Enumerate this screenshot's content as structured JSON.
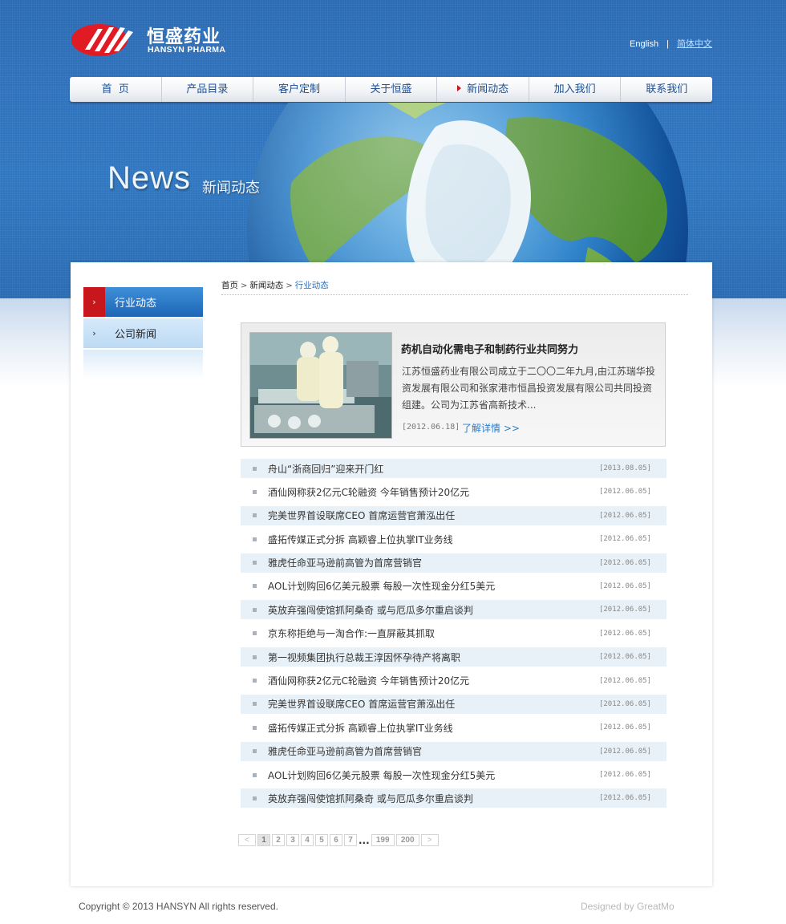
{
  "brand": {
    "name_cn": "恒盛药业",
    "name_en": "HANSYN PHARMA",
    "colors": {
      "primary_blue": "#2c6bb3",
      "accent_red": "#c8161d",
      "link_blue": "#2a7ec9"
    }
  },
  "language": {
    "english": "English",
    "separator": "|",
    "chinese": "简体中文"
  },
  "nav": {
    "items": [
      {
        "label": "首  页"
      },
      {
        "label": "产品目录"
      },
      {
        "label": "客户定制"
      },
      {
        "label": "关于恒盛"
      },
      {
        "label": "新闻动态",
        "active": true
      },
      {
        "label": "加入我们"
      },
      {
        "label": "联系我们"
      }
    ]
  },
  "banner": {
    "title": "News",
    "subtitle": "新闻动态"
  },
  "sidebar": {
    "items": [
      {
        "label": "行业动态",
        "icon": "chevron-right-icon",
        "active": true
      },
      {
        "label": "公司新闻",
        "icon": "chevron-right-icon",
        "active": false
      }
    ]
  },
  "breadcrumb": {
    "items": [
      "首页",
      "新闻动态",
      "行业动态"
    ],
    "separator": ">"
  },
  "featured": {
    "title": "药机自动化需电子和制药行业共同努力",
    "summary": "江苏恒盛药业有限公司成立于二〇〇二年九月,由江苏瑞华投资发展有限公司和张家港市恒昌投资发展有限公司共同投资组建。公司为江苏省高新技术...",
    "date": "[2012.06.18]",
    "more": "了解详情 >>"
  },
  "news": [
    {
      "title": "舟山“浙商回归”迎来开门红",
      "date": "[2013.08.05]"
    },
    {
      "title": "酒仙网称获2亿元C轮融资 今年销售预计20亿元",
      "date": "[2012.06.05]"
    },
    {
      "title": "完美世界首设联席CEO 首席运营官萧泓出任",
      "date": "[2012.06.05]"
    },
    {
      "title": "盛拓传媒正式分拆 高颖睿上位执掌IT业务线",
      "date": "[2012.06.05]"
    },
    {
      "title": "雅虎任命亚马逊前高管为首席营销官",
      "date": "[2012.06.05]"
    },
    {
      "title": "AOL计划购回6亿美元股票 每股一次性现金分红5美元",
      "date": "[2012.06.05]"
    },
    {
      "title": "英放弃强闯使馆抓阿桑奇 或与厄瓜多尔重启谈判",
      "date": "[2012.06.05]"
    },
    {
      "title": "京东称拒绝与一淘合作:一直屏蔽其抓取",
      "date": "[2012.06.05]"
    },
    {
      "title": "第一视频集团执行总裁王淳因怀孕待产将离职",
      "date": "[2012.06.05]"
    },
    {
      "title": "酒仙网称获2亿元C轮融资 今年销售预计20亿元",
      "date": "[2012.06.05]"
    },
    {
      "title": "完美世界首设联席CEO 首席运营官萧泓出任",
      "date": "[2012.06.05]"
    },
    {
      "title": "盛拓传媒正式分拆 高颖睿上位执掌IT业务线",
      "date": "[2012.06.05]"
    },
    {
      "title": "雅虎任命亚马逊前高管为首席营销官",
      "date": "[2012.06.05]"
    },
    {
      "title": "AOL计划购回6亿美元股票 每股一次性现金分红5美元",
      "date": "[2012.06.05]"
    },
    {
      "title": "英放弃强闯使馆抓阿桑奇 或与厄瓜多尔重启谈判",
      "date": "[2012.06.05]"
    }
  ],
  "pager": {
    "prev": "<",
    "pages": [
      "1",
      "2",
      "3",
      "4",
      "5",
      "6",
      "7"
    ],
    "ellipsis": "...",
    "last_pages": [
      "199",
      "200"
    ],
    "next": ">",
    "current": "1"
  },
  "footer": {
    "copyright": "Copyright © 2013 HANSYN All rights reserved.",
    "designer": "Designed by GreatMo"
  }
}
